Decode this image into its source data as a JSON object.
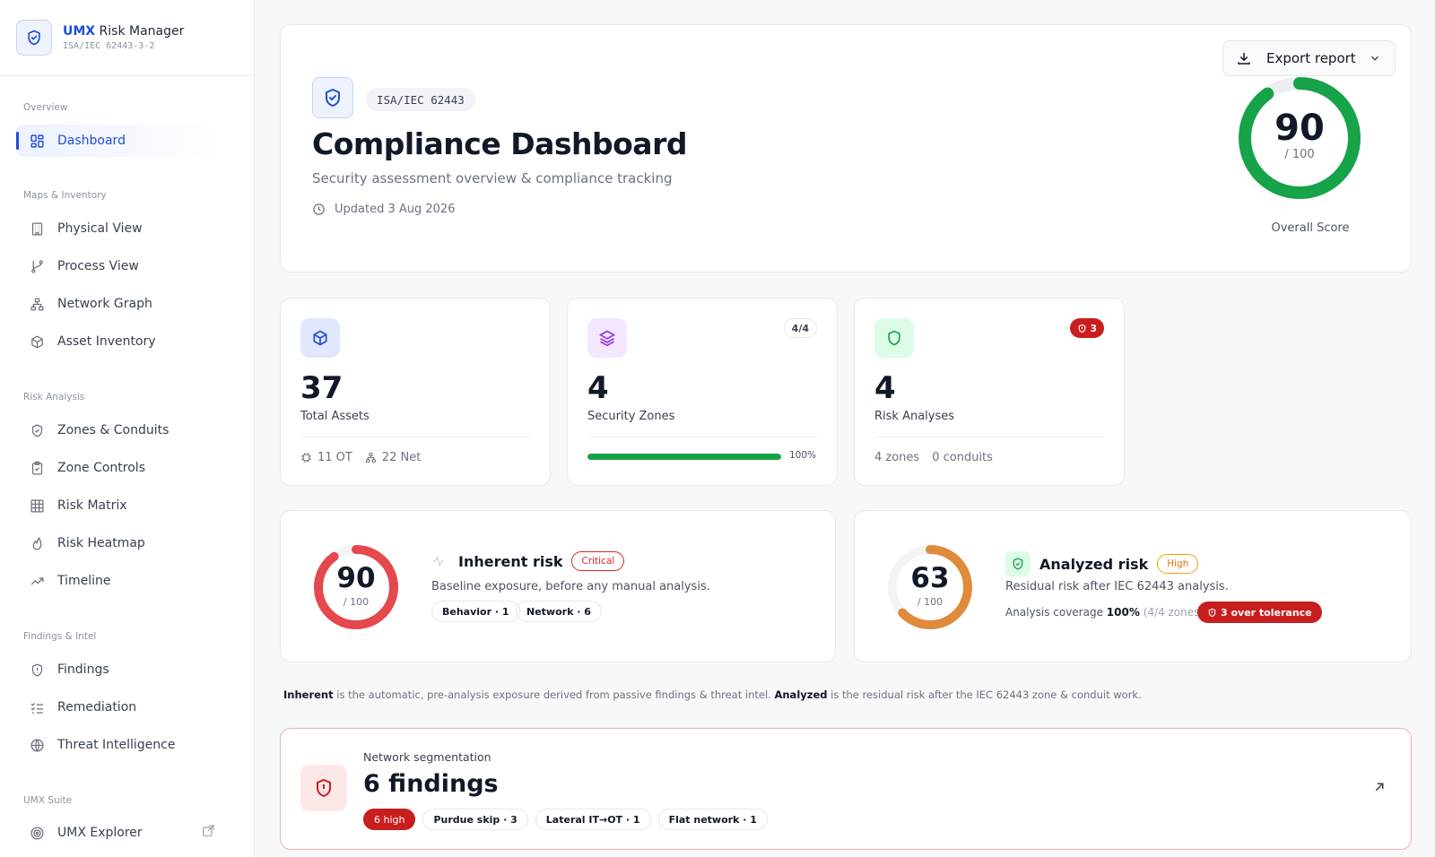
{
  "brand": {
    "accent": "UMX",
    "title": "Risk Manager",
    "subtitle": "ISA/IEC 62443-3-2"
  },
  "sidebar": {
    "sections": {
      "overview": "Overview",
      "maps": "Maps & Inventory",
      "risk": "Risk Analysis",
      "findings": "Findings & Intel",
      "suite": "UMX Suite"
    },
    "items": {
      "dashboard": "Dashboard",
      "physical": "Physical View",
      "process": "Process View",
      "network": "Network Graph",
      "asset": "Asset Inventory",
      "zones": "Zones & Conduits",
      "controls": "Zone Controls",
      "matrix": "Risk Matrix",
      "heatmap": "Risk Heatmap",
      "timeline": "Timeline",
      "findings": "Findings",
      "remediation": "Remediation",
      "threat": "Threat Intelligence",
      "explorer": "UMX Explorer"
    }
  },
  "hero": {
    "chip": "ISA/IEC 62443",
    "title": "Compliance Dashboard",
    "subtitle": "Security assessment overview & compliance tracking",
    "updated": "Updated 3 Aug 2026",
    "export_label": "Export report",
    "score": "90",
    "score_den": "/ 100",
    "score_fraction": 0.9,
    "score_label": "Overall Score"
  },
  "stats": {
    "assets": {
      "value": "37",
      "label": "Total Assets",
      "ot": "11 OT",
      "net": "22 Net"
    },
    "zones": {
      "value": "4",
      "label": "Security Zones",
      "badge": "4/4",
      "progress": 1.0,
      "pct": "100%"
    },
    "analyses": {
      "value": "4",
      "label": "Risk Analyses",
      "badge": "3",
      "zones": "4 zones",
      "conduits": "0 conduits"
    }
  },
  "inherent": {
    "score": "90",
    "den": "/ 100",
    "fraction": 0.9,
    "title": "Inherent risk",
    "tag": "Critical",
    "desc": "Baseline exposure, before any manual analysis.",
    "pills": [
      "Behavior · 1",
      "Network · 6"
    ]
  },
  "analyzed": {
    "score": "63",
    "den": "/ 100",
    "fraction": 0.63,
    "title": "Analyzed risk",
    "tag": "High",
    "desc": "Residual risk after IEC 62443 analysis.",
    "coverage_label": "Analysis coverage",
    "coverage_value": "100%",
    "coverage_detail": "(4/4 zones)",
    "tolerance": "3 over tolerance"
  },
  "note": {
    "inherent_b": "Inherent",
    "inherent_t": " is the automatic, pre-analysis exposure derived from passive findings & threat intel. ",
    "analyzed_b": "Analyzed",
    "analyzed_t": " is the residual risk after the IEC 62443 zone & conduit work."
  },
  "segmentation": {
    "kicker": "Network segmentation",
    "title": "6 findings",
    "high": "6 high",
    "pills": [
      "Purdue skip · 3",
      "Lateral IT→OT · 1",
      "Flat network · 1"
    ]
  },
  "colors": {
    "accent": "#1d4ed8",
    "good": "#16a34a",
    "critical": "#e5484d",
    "high": "#e08a3c",
    "danger": "#c81e1e"
  }
}
